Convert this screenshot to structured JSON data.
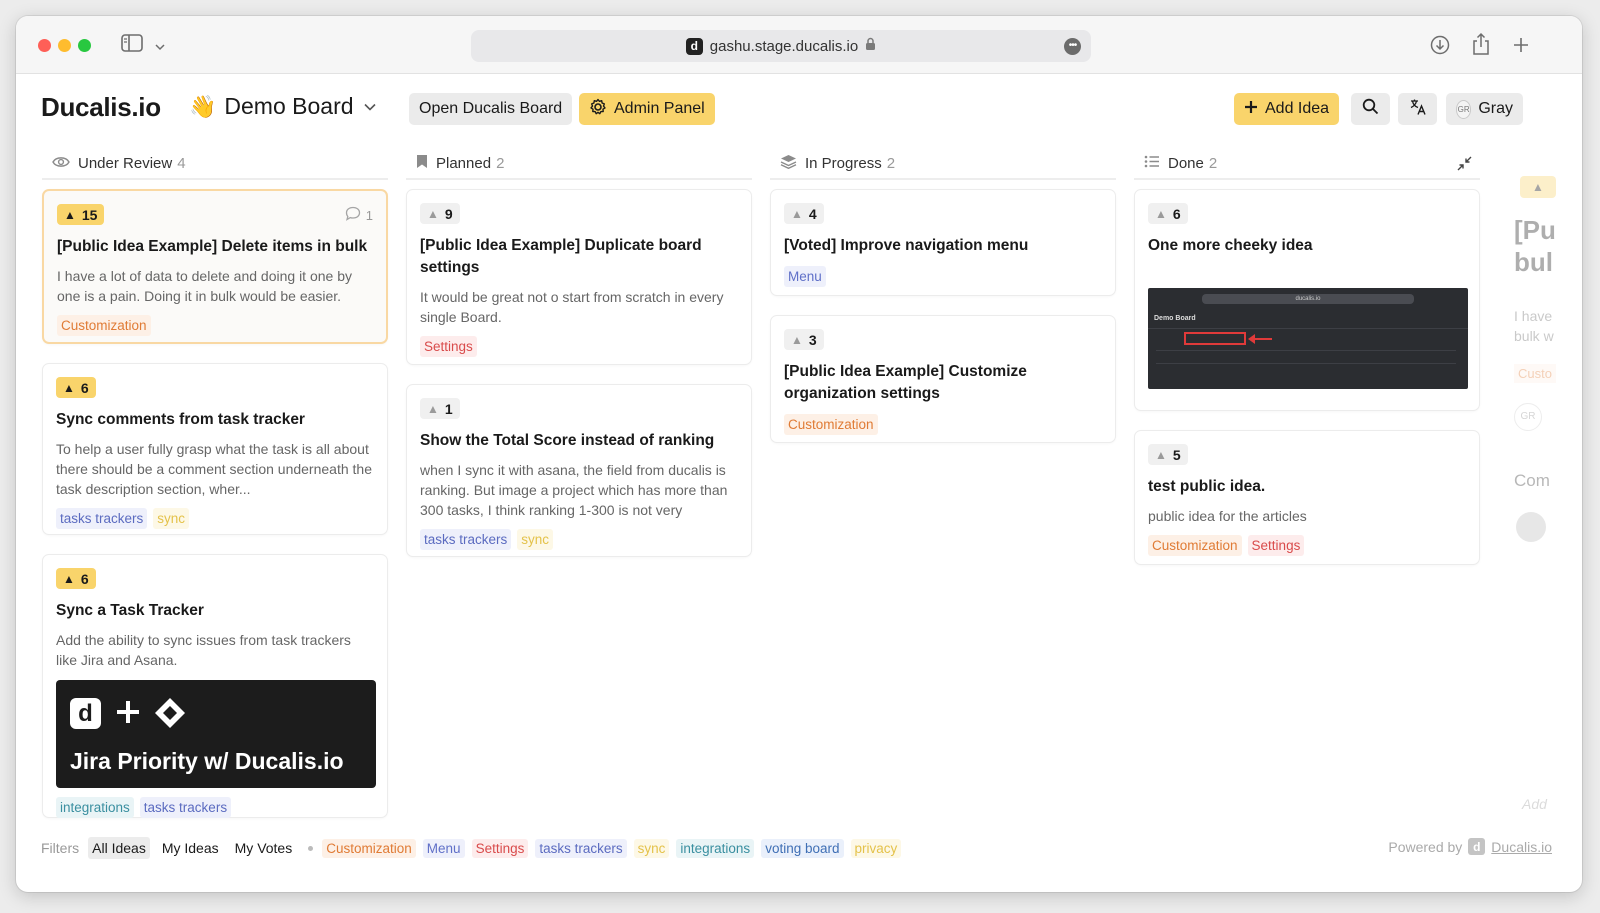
{
  "browser": {
    "url": "gashu.stage.ducalis.io",
    "site_icon": "d"
  },
  "header": {
    "brand": "Ducalis.io",
    "board_emoji": "👋",
    "board_name": "Demo Board",
    "open_board_label": "Open Ducalis Board",
    "admin_panel_label": "Admin Panel",
    "add_idea_label": "Add Idea",
    "user_initials": "GR",
    "user_name": "Gray"
  },
  "columns": [
    {
      "title": "Under Review",
      "count": "4",
      "cards": [
        {
          "votes": "15",
          "voted": true,
          "comments": "1",
          "title": "[Public Idea Example] Delete items in bulk",
          "desc": "I have a lot of data to delete and doing it one by one is a pain. Doing it in bulk would be easier.",
          "tags": [
            "Customization"
          ]
        },
        {
          "votes": "6",
          "voted": true,
          "title": "Sync comments from task tracker",
          "desc": "To help a user fully grasp what the task is all about there should be a comment section underneath the task description section, wher...",
          "tags": [
            "tasks trackers",
            "sync"
          ]
        },
        {
          "votes": "6",
          "voted": true,
          "title": "Sync a Task Tracker",
          "desc": "Add the ability to sync issues from task trackers like Jira and Asana.",
          "image_text": "Jira Priority w/ Ducalis.io",
          "image_logo": "d",
          "tags": [
            "integrations",
            "tasks trackers"
          ]
        }
      ]
    },
    {
      "title": "Planned",
      "count": "2",
      "cards": [
        {
          "votes": "9",
          "voted": false,
          "title": "[Public Idea Example] Duplicate board settings",
          "desc": "It would be great not o start from scratch in every single Board.",
          "tags": [
            "Settings"
          ]
        },
        {
          "votes": "1",
          "voted": false,
          "title": "Show the Total Score instead of ranking",
          "desc": "when I sync it with asana, the field from ducalis is ranking. But image a project which has more than 300 tasks, I think ranking 1-300 is not very",
          "tags": [
            "tasks trackers",
            "sync"
          ]
        }
      ]
    },
    {
      "title": "In Progress",
      "count": "2",
      "cards": [
        {
          "votes": "4",
          "voted": false,
          "title": "[Voted] Improve navigation menu",
          "tags": [
            "Menu"
          ]
        },
        {
          "votes": "3",
          "voted": false,
          "title": "[Public Idea Example] Customize organization settings",
          "tags": [
            "Customization"
          ]
        }
      ]
    },
    {
      "title": "Done",
      "count": "2",
      "cards": [
        {
          "votes": "6",
          "voted": false,
          "title": "One more cheeky idea",
          "screenshot_title": "Demo Board",
          "screenshot_url": "ducalis.io"
        },
        {
          "votes": "5",
          "voted": false,
          "title": "test public idea.",
          "desc": "public idea for the articles",
          "tags": [
            "Customization",
            "Settings"
          ]
        }
      ]
    }
  ],
  "ghost_column": {
    "title_part1": "[Pu",
    "title_part2": "bul",
    "desc_part1": "I have",
    "desc_part2": "bulk w",
    "tag": "Custo",
    "avatar": "GR",
    "section": "Com",
    "input": "Add"
  },
  "tag_colors": {
    "Customization": {
      "bg": "#fdf0e6",
      "fg": "#e07b35"
    },
    "Menu": {
      "bg": "#eef0fb",
      "fg": "#6070c8"
    },
    "Settings": {
      "bg": "#fdecec",
      "fg": "#d94b4b"
    },
    "tasks trackers": {
      "bg": "#eef0fb",
      "fg": "#5b6bc0"
    },
    "sync": {
      "bg": "#fdf8e6",
      "fg": "#e4c24a"
    },
    "integrations": {
      "bg": "#e9f4f6",
      "fg": "#3a8fa0"
    },
    "voting board": {
      "bg": "#eaf0fb",
      "fg": "#3f6fb5"
    },
    "privacy": {
      "bg": "#fdf8e6",
      "fg": "#e4c24a"
    }
  },
  "footer": {
    "filters_label": "Filters",
    "all_ideas": "All Ideas",
    "my_ideas": "My Ideas",
    "my_votes": "My Votes",
    "tags": [
      "Customization",
      "Menu",
      "Settings",
      "tasks trackers",
      "sync",
      "integrations",
      "voting board",
      "privacy"
    ],
    "powered_by": "Powered by",
    "powered_link": "Ducalis.io",
    "powered_icon": "d"
  }
}
